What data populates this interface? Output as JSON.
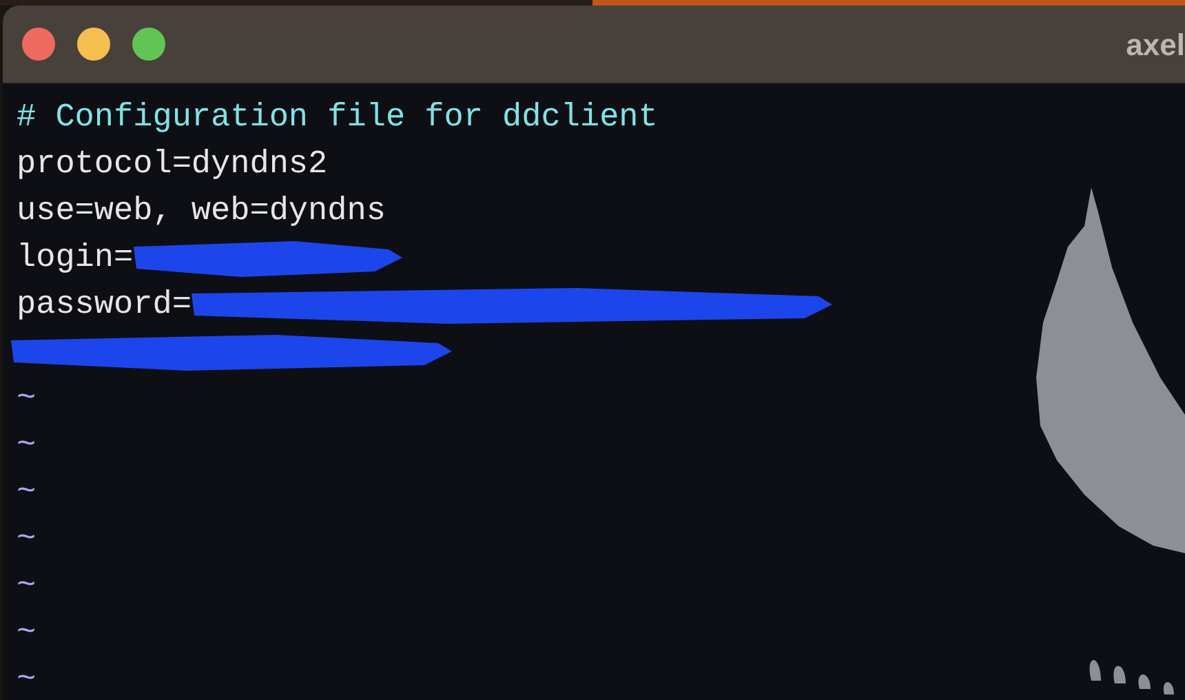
{
  "window": {
    "title": "axel"
  },
  "buffer": {
    "lines": [
      {
        "kind": "comment",
        "text": "# Configuration file for ddclient"
      },
      {
        "kind": "setting",
        "text": "protocol=dyndns2"
      },
      {
        "kind": "setting",
        "text": "use=web, web=dyndns"
      },
      {
        "kind": "setting",
        "text": "login=",
        "redacted": true
      },
      {
        "kind": "setting",
        "text": "password=",
        "redacted": true
      },
      {
        "redacted": true
      },
      {
        "kind": "empty",
        "text": "~"
      },
      {
        "kind": "empty",
        "text": "~"
      },
      {
        "kind": "empty",
        "text": "~"
      },
      {
        "kind": "empty",
        "text": "~"
      },
      {
        "kind": "empty",
        "text": "~"
      },
      {
        "kind": "empty",
        "text": "~"
      },
      {
        "kind": "empty",
        "text": "~"
      }
    ]
  }
}
